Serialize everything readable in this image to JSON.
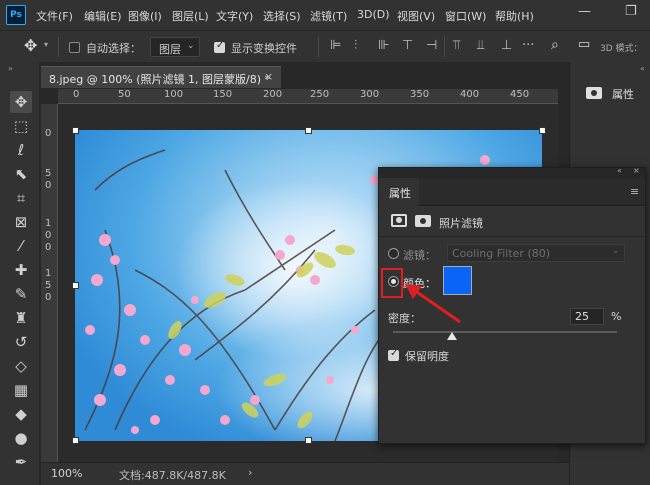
{
  "app": {
    "logo": "Ps"
  },
  "menu": [
    "文件(F)",
    "编辑(E)",
    "图像(I)",
    "图层(L)",
    "文字(Y)",
    "选择(S)",
    "滤镜(T)",
    "3D(D)",
    "视图(V)",
    "窗口(W)",
    "帮助(H)"
  ],
  "window_controls": {
    "minimize": "—",
    "restore": "❐"
  },
  "options_bar": {
    "auto_select_label": "自动选择：",
    "layer_select_value": "图层",
    "show_transform_label": "显示变换控件",
    "mode_3d_label": "3D 模式："
  },
  "document": {
    "tab_title": "8.jpeg @ 100% (照片滤镜 1, 图层蒙版/8) *",
    "close": "×",
    "ruler_ticks": [
      "0",
      "50",
      "100",
      "150",
      "200",
      "250",
      "300",
      "350",
      "400",
      "450"
    ],
    "ruler_left_ticks": [
      "0",
      "5",
      "0",
      "1",
      "0",
      "0",
      "1",
      "5",
      "0"
    ]
  },
  "status": {
    "zoom": "100%",
    "doc_info": "文档:487.8K/487.8K",
    "arrow": "›"
  },
  "right_dock": {
    "properties_label": "属性"
  },
  "properties_panel": {
    "tab_label": "属性",
    "adjustment_name": "照片滤镜",
    "filter_label": "滤镜：",
    "filter_value": "Cooling Filter (80)",
    "color_label": "颜色：",
    "color_value": "#0a64f5",
    "density_label": "密度：",
    "density_value": "25",
    "density_unit": "%",
    "density_level": 0.25,
    "preserve_label": "保留明度",
    "preserve_checked": true,
    "selected_option": "color"
  },
  "annotation_color": "#e02020"
}
